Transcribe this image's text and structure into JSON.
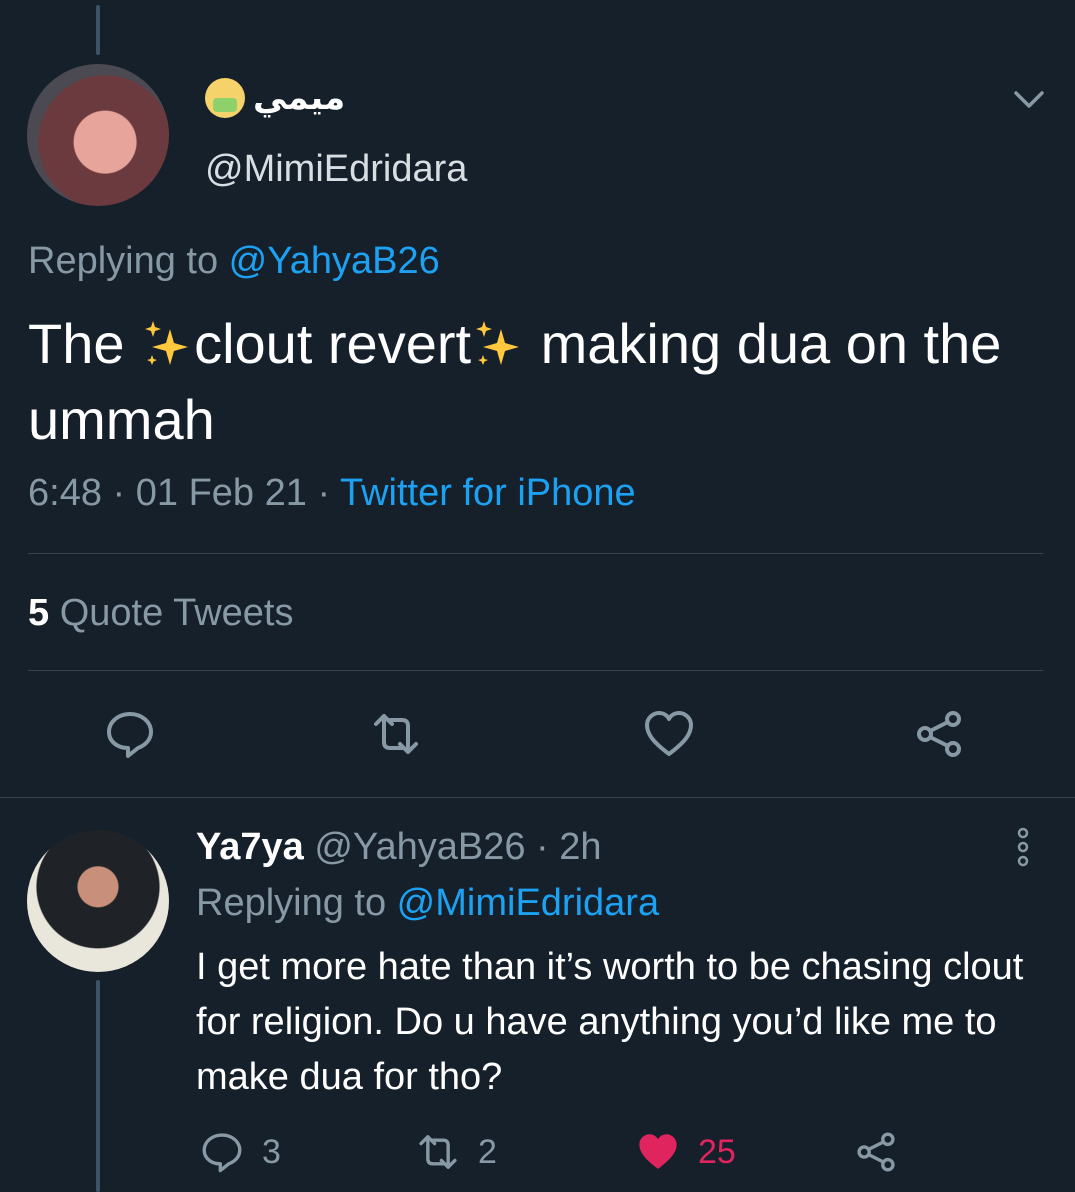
{
  "main_tweet": {
    "display_name": "ميمي",
    "handle": "@MimiEdridara",
    "replying_prefix": "Replying to ",
    "replying_to": "@YahyaB26",
    "text_parts": [
      "The ",
      "clout revert",
      " making dua on the ummah"
    ],
    "time": "6:48",
    "date": "01 Feb 21",
    "source": "Twitter for iPhone",
    "quote_count": "5",
    "quote_label": "Quote Tweets"
  },
  "reply_tweet": {
    "display_name": "Ya7ya",
    "handle": "@YahyaB26",
    "age": "2h",
    "replying_prefix": "Replying to ",
    "replying_to": "@MimiEdridara",
    "text": "I get more hate than it’s worth to be chasing clout for religion. Do u have anything you’d like me to make dua for tho?",
    "reply_count": "3",
    "retweet_count": "2",
    "like_count": "25",
    "liked": true
  },
  "colors": {
    "background": "#15202b",
    "link": "#1da1f2",
    "muted": "#8899a6",
    "like": "#e0245e",
    "divider": "#38444d"
  },
  "icons": [
    "chevron-down-icon",
    "sparkles-icon",
    "reply-icon",
    "retweet-icon",
    "heart-icon",
    "share-icon",
    "more-icon"
  ]
}
